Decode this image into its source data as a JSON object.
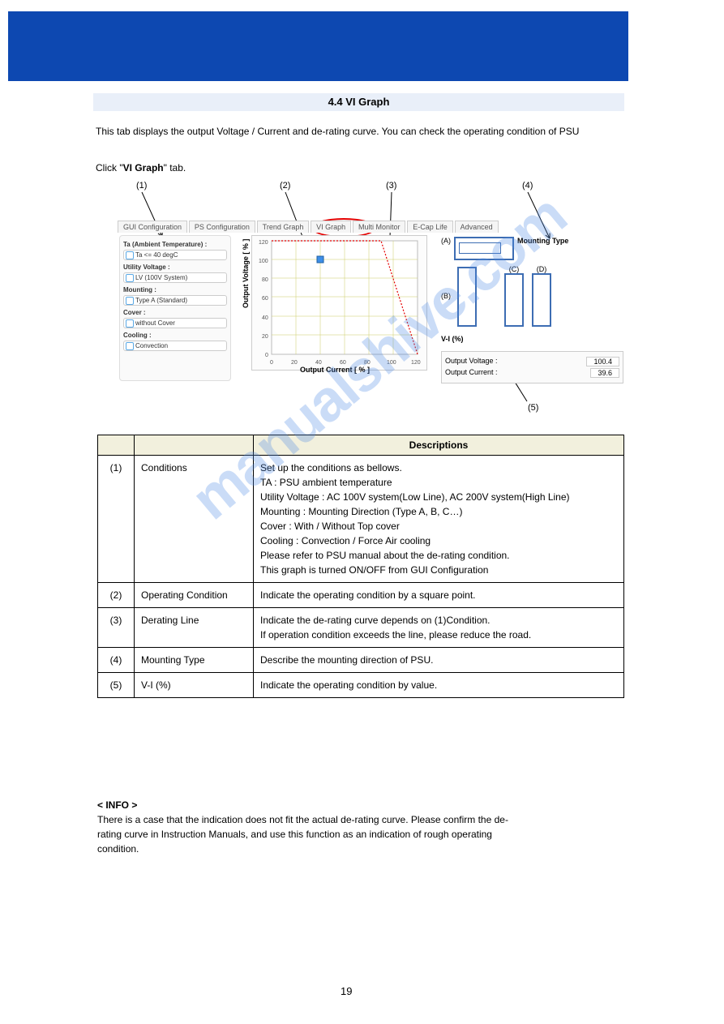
{
  "section_title": "4.4 VI Graph",
  "section_intro": "This tab displays the output Voltage / Current and de-rating curve. You can check the operating condition of PSU",
  "tab_label_pre": "Click \"",
  "tab_name_bold": "VI Graph",
  "tab_label_post": "\" tab.",
  "annot": {
    "a1": "(1)",
    "a2": "(2)",
    "a3": "(3)",
    "a4": "(4)",
    "a5": "(5)"
  },
  "tabs": [
    "GUI Configuration",
    "PS Configuration",
    "Trend Graph",
    "VI Graph",
    "Multi Monitor",
    "E-Cap Life",
    "Advanced"
  ],
  "cond": {
    "ta_label": "Ta (Ambient Temperature) :",
    "ta_val": "Ta <= 40 degC",
    "uv_label": "Utility Voltage :",
    "uv_val": "LV (100V System)",
    "mnt_label": "Mounting :",
    "mnt_val": "Type A (Standard)",
    "cov_label": "Cover :",
    "cov_val": "without Cover",
    "cool_label": "Cooling :",
    "cool_val": "Convection"
  },
  "chart_data": {
    "type": "line",
    "xlabel": "Output Current [ % ]",
    "ylabel": "Output Voltage [ % ]",
    "x_ticks": [
      0,
      20,
      40,
      60,
      80,
      100,
      120
    ],
    "y_ticks": [
      0,
      20,
      40,
      60,
      80,
      100,
      120
    ],
    "operating_point": {
      "x": 40,
      "y": 100
    },
    "derating_series": {
      "name": "de-rating",
      "x": [
        0,
        90,
        120
      ],
      "y": [
        120,
        120,
        0
      ],
      "style": "red-dashed"
    },
    "xlim": [
      0,
      120
    ],
    "ylim": [
      0,
      120
    ]
  },
  "right": {
    "mt_label": "Mounting Type",
    "a": "(A)",
    "b": "(B)",
    "c": "(C)",
    "d": "(D)",
    "vi_title": "V-I (%)",
    "ov_label": "Output Voltage :",
    "ov_val": "100.4",
    "oc_label": "Output Current :",
    "oc_val": "39.6"
  },
  "table": {
    "h1": "",
    "h2": "",
    "h3": "Descriptions",
    "rows": [
      {
        "n": "(1)",
        "label": "Conditions",
        "desc_lines": [
          "Set up the conditions as bellows.",
          "TA : PSU ambient temperature",
          "Utility Voltage : AC 100V system(Low Line), AC 200V system(High Line)",
          "Mounting : Mounting Direction (Type A, B, C…)",
          "Cover : With / Without Top cover",
          "Cooling : Convection / Force Air cooling",
          "Please refer to PSU manual about the de-rating condition.",
          "This graph is turned ON/OFF from GUI Configuration"
        ]
      },
      {
        "n": "(2)",
        "label": "Operating Condition",
        "desc_lines": [
          "Indicate the operating condition by a square point."
        ]
      },
      {
        "n": "(3)",
        "label": "Derating Line",
        "desc_lines": [
          "Indicate the de-rating curve depends on (1)Condition.",
          "If operation condition exceeds the line, please reduce the road."
        ]
      },
      {
        "n": "(4)",
        "label": "Mounting Type",
        "desc_lines": [
          "Describe the mounting direction of PSU."
        ]
      },
      {
        "n": "(5)",
        "label": "V-I (%)",
        "desc_lines": [
          "Indicate the operating condition by value."
        ]
      }
    ]
  },
  "footer_lines": [
    "",
    "There is a case that the indication does not fit the actual de-rating curve. Please confirm the de-",
    "rating curve in Instruction Manuals, and use this function as an indication of rough operating",
    "condition."
  ],
  "footer_label": "< INFO >",
  "page_num": "19",
  "watermark": "manualshive.com"
}
